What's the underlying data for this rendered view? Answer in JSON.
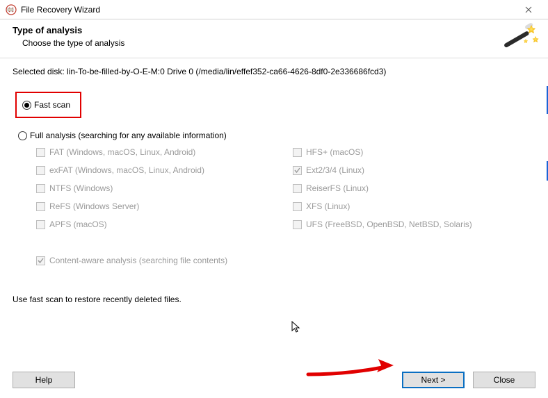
{
  "window": {
    "title": "File Recovery Wizard"
  },
  "header": {
    "heading": "Type of analysis",
    "subheading": "Choose the type of analysis"
  },
  "selected_disk_label": "Selected disk: lin-To-be-filled-by-O-E-M:0 Drive 0 (/media/lin/effef352-ca66-4626-8df0-2e336686fcd3)",
  "options": {
    "fast_scan": {
      "label": "Fast scan",
      "checked": true
    },
    "full_analysis": {
      "label": "Full analysis (searching for any available information)",
      "checked": false
    }
  },
  "filesystems": {
    "left": [
      {
        "key": "fat",
        "label": "FAT (Windows, macOS, Linux, Android)",
        "checked": false
      },
      {
        "key": "exfat",
        "label": "exFAT (Windows, macOS, Linux, Android)",
        "checked": false
      },
      {
        "key": "ntfs",
        "label": "NTFS (Windows)",
        "checked": false
      },
      {
        "key": "refs",
        "label": "ReFS (Windows Server)",
        "checked": false
      },
      {
        "key": "apfs",
        "label": "APFS (macOS)",
        "checked": false
      }
    ],
    "right": [
      {
        "key": "hfs",
        "label": "HFS+ (macOS)",
        "checked": false
      },
      {
        "key": "ext",
        "label": "Ext2/3/4 (Linux)",
        "checked": true
      },
      {
        "key": "reiser",
        "label": "ReiserFS (Linux)",
        "checked": false
      },
      {
        "key": "xfs",
        "label": "XFS (Linux)",
        "checked": false
      },
      {
        "key": "ufs",
        "label": "UFS (FreeBSD, OpenBSD, NetBSD, Solaris)",
        "checked": false
      }
    ]
  },
  "content_aware": {
    "label": "Content-aware analysis (searching file contents)",
    "checked": true
  },
  "hint": "Use fast scan to restore recently deleted files.",
  "buttons": {
    "help": "Help",
    "next": "Next >",
    "close": "Close"
  }
}
